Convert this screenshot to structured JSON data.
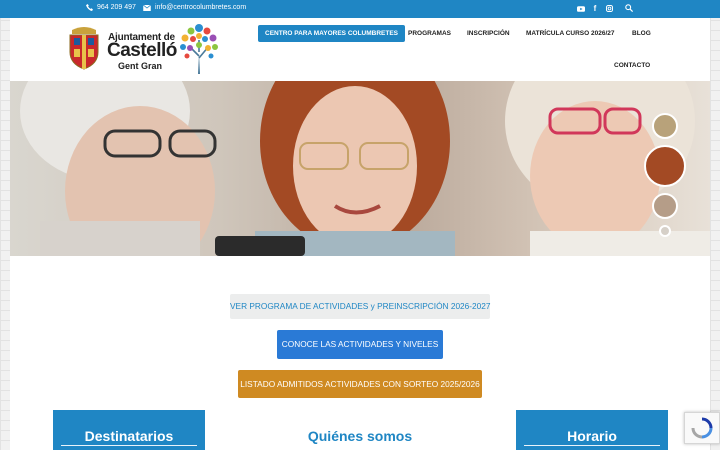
{
  "topbar": {
    "phone": "964 209 497",
    "email": "info@centrocolumbretes.com",
    "social": [
      "youtube-icon",
      "facebook-icon",
      "instagram-icon",
      "search-icon"
    ]
  },
  "logo": {
    "line1": "Ajuntament de",
    "line2": "Castelló",
    "line3": "Gent Gran"
  },
  "nav": {
    "items": [
      {
        "label": "CENTRO PARA MAYORES COLUMBRETES",
        "active": true
      },
      {
        "label": "PROGRAMAS"
      },
      {
        "label": "INSCRIPCIÓN"
      },
      {
        "label": "MATRÍCULA CURSO 2026/27"
      },
      {
        "label": "BLOG"
      },
      {
        "label": "CONTACTO"
      }
    ]
  },
  "buttons": {
    "program": "VER PROGRAMA DE ACTIVIDADES y PREINSCRIPCIÓN 2026-2027",
    "levels": "CONOCE LAS ACTIVIDADES Y NIVELES",
    "admitted": "LISTADO ADMITIDOS ACTIVIDADES CON SORTEO 2025/2026"
  },
  "sections": {
    "destinatarios": "Destinatarios",
    "quienes": "Quiénes somos",
    "horario": "Horario"
  },
  "colors": {
    "accent": "#1f86c4",
    "button_blue": "#2a7ad6",
    "button_orange": "#cf8a22"
  }
}
